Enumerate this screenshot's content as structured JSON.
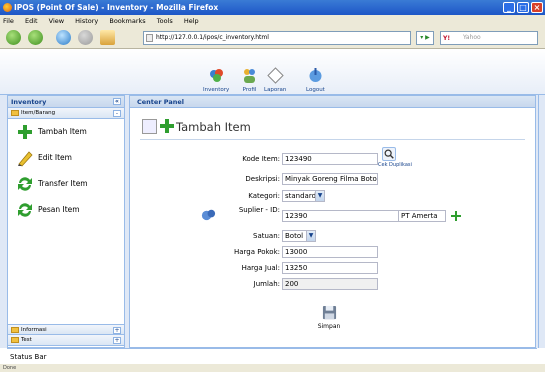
{
  "browser": {
    "window_title": "IPOS (Point Of Sale) - Inventory - Mozilla Firefox",
    "menu": [
      "File",
      "Edit",
      "View",
      "History",
      "Bookmarks",
      "Tools",
      "Help"
    ],
    "url": "http://127.0.0.1/ipos/c_inventory.html",
    "search_placeholder": "Yahoo",
    "status_text": "Done"
  },
  "toolbar": {
    "items": [
      {
        "label": "Inventory",
        "icon": "inventory-icon"
      },
      {
        "label": "Profil",
        "icon": "profile-icon"
      },
      {
        "label": "Laporan",
        "icon": "report-icon"
      },
      {
        "label": "Logout",
        "icon": "logout-icon"
      }
    ]
  },
  "west": {
    "title": "Inventory",
    "group_top": "Item/Barang",
    "items": [
      {
        "label": "Tambah Item",
        "icon": "add-icon"
      },
      {
        "label": "Edit Item",
        "icon": "pencil-icon"
      },
      {
        "label": "Transfer Item",
        "icon": "refresh-icon"
      },
      {
        "label": "Pesan Item",
        "icon": "order-icon"
      }
    ],
    "group_informasi": "Informasi",
    "group_test": "Test"
  },
  "center": {
    "tab": "Center Panel",
    "form_title": "Tambah Item",
    "fields": {
      "kode_label": "Kode Item:",
      "kode_value": "123490",
      "cek_link": "Cek Duplikasi",
      "deskripsi_label": "Deskripsi:",
      "deskripsi_value": "Minyak Goreng Filma Botol",
      "kategori_label": "Kategori:",
      "kategori_value": "standard",
      "suplier_label": "Suplier - ID:",
      "suplier_value": "12390",
      "suplier_name": "PT Amerta",
      "satuan_label": "Satuan:",
      "satuan_value": "Botol",
      "harga_pokok_label": "Harga Pokok:",
      "harga_pokok_value": "13000",
      "harga_jual_label": "Harga Jual:",
      "harga_jual_value": "13250",
      "jumlah_label": "Jumlah:",
      "jumlah_value": "200"
    },
    "save_label": "Simpan"
  },
  "status_bar": "Status Bar"
}
